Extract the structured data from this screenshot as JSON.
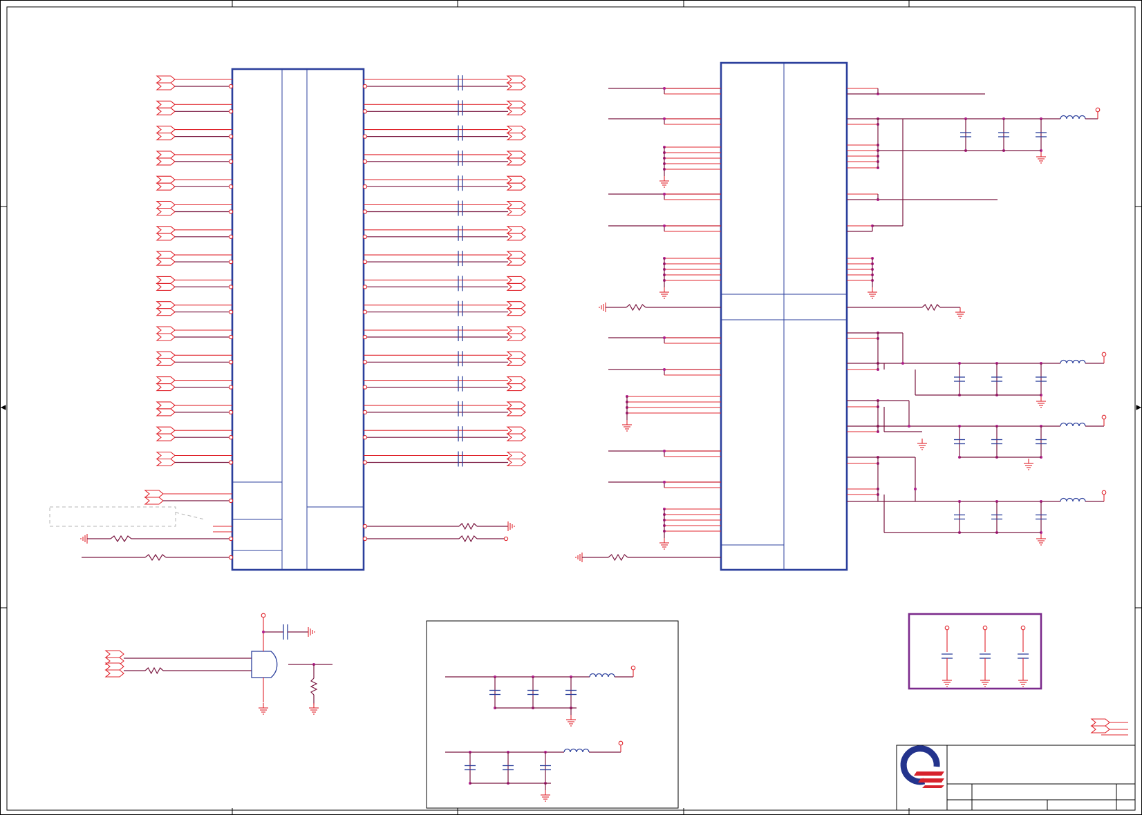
{
  "sheet": {
    "frame_color": "#000000",
    "wire_color": "#7a1740",
    "pin_color": "#e0242c",
    "body_color": "#2b3f9c",
    "junction_color": "#b0208c",
    "highlight_color": "#7b2a8c",
    "dashed_color": "#b5b5b5"
  },
  "logo": {
    "name": "quanta-logo-icon",
    "ring_color": "#23338c",
    "stripe_color": "#d7232d"
  },
  "left_chip": {
    "left_port_rows": 16,
    "right_capacitor_rows": 16
  },
  "right_chip": {
    "supply_branches": 4
  },
  "decoupling_box": {
    "caps": 3
  }
}
